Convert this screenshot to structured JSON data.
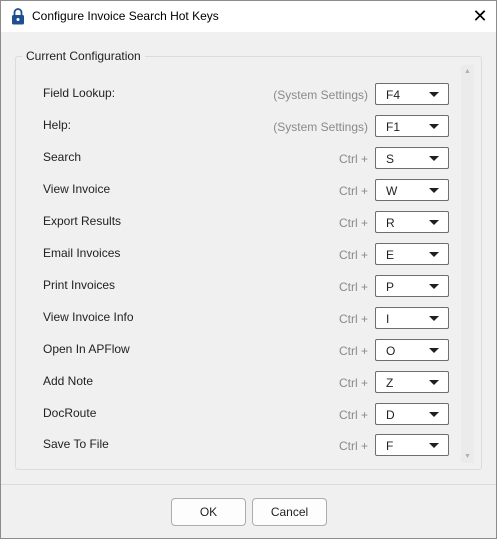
{
  "window": {
    "title": "Configure Invoice Search Hot Keys",
    "close_glyph": "✕",
    "icon": "lock-icon"
  },
  "group": {
    "title": "Current Configuration"
  },
  "hotkeys": [
    {
      "label": "Field Lookup:",
      "prefix": "(System Settings)",
      "key": "F4"
    },
    {
      "label": "Help:",
      "prefix": "(System Settings)",
      "key": "F1"
    },
    {
      "label": "Search",
      "prefix": "Ctrl +",
      "key": "S"
    },
    {
      "label": "View Invoice",
      "prefix": "Ctrl +",
      "key": "W"
    },
    {
      "label": "Export Results",
      "prefix": "Ctrl +",
      "key": "R"
    },
    {
      "label": "Email Invoices",
      "prefix": "Ctrl +",
      "key": "E"
    },
    {
      "label": "Print Invoices",
      "prefix": "Ctrl +",
      "key": "P"
    },
    {
      "label": "View Invoice Info",
      "prefix": "Ctrl +",
      "key": "I"
    },
    {
      "label": "Open In APFlow",
      "prefix": "Ctrl +",
      "key": "O"
    },
    {
      "label": "Add Note",
      "prefix": "Ctrl +",
      "key": "Z"
    },
    {
      "label": "DocRoute",
      "prefix": "Ctrl +",
      "key": "D"
    },
    {
      "label": "Save To File",
      "prefix": "Ctrl +",
      "key": "F"
    }
  ],
  "buttons": {
    "ok": "OK",
    "cancel": "Cancel"
  },
  "colors": {
    "dialog_bg": "#f0f0f0",
    "titlebar_bg": "#ffffff",
    "lock_icon": "#1d4f91"
  }
}
